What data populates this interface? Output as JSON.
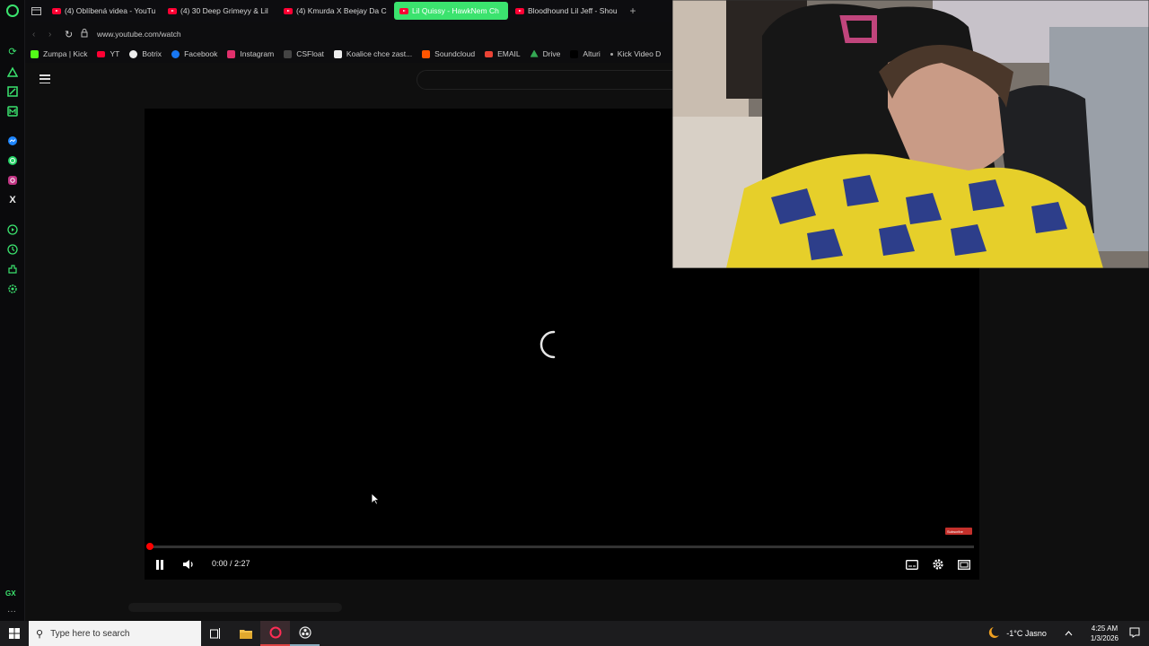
{
  "tabs": [
    {
      "label": "(4) Oblíbená videa - YouTube",
      "active": false
    },
    {
      "label": "(4) 30 Deep Grimeyy & Lil",
      "active": false
    },
    {
      "label": "(4) Kmurda X Beejay Da C",
      "active": false
    },
    {
      "label": "Lil Quissy - HawkNem Ch",
      "active": true
    },
    {
      "label": "Bloodhound Lil Jeff - Shou",
      "active": false
    }
  ],
  "new_tab": "+",
  "address": {
    "url": "www.youtube.com/watch"
  },
  "bookmarks": [
    {
      "label": "Zumpa | Kick",
      "color": "#53fc18"
    },
    {
      "label": "YT",
      "color": "#ff0033"
    },
    {
      "label": "Botrix",
      "color": "#ffffff"
    },
    {
      "label": "Facebook",
      "color": "#1877f2"
    },
    {
      "label": "Instagram",
      "color": "#e1306c"
    },
    {
      "label": "CSFloat",
      "color": "#444444"
    },
    {
      "label": "Koalice chce zast...",
      "color": "#ffffff"
    },
    {
      "label": "Soundcloud",
      "color": "#ff5500"
    },
    {
      "label": "EMAIL",
      "color": "#ea4335"
    },
    {
      "label": "Drive",
      "color": "#34a853"
    },
    {
      "label": "Alturi",
      "color": "#000000"
    },
    {
      "label": "Kick Video D",
      "color": "#000000"
    }
  ],
  "player": {
    "time": "0:00 / 2:27",
    "progress": 0.0,
    "state": "buffering",
    "subscribe_badge": "Subscribe"
  },
  "taskbar": {
    "search_placeholder": "Type here to search",
    "weather": "-1°C  Jasno",
    "time": "4:25 AM",
    "date": "1/3/2026"
  },
  "sidebar_rail": {
    "gx_label": "GX",
    "more": "···"
  }
}
